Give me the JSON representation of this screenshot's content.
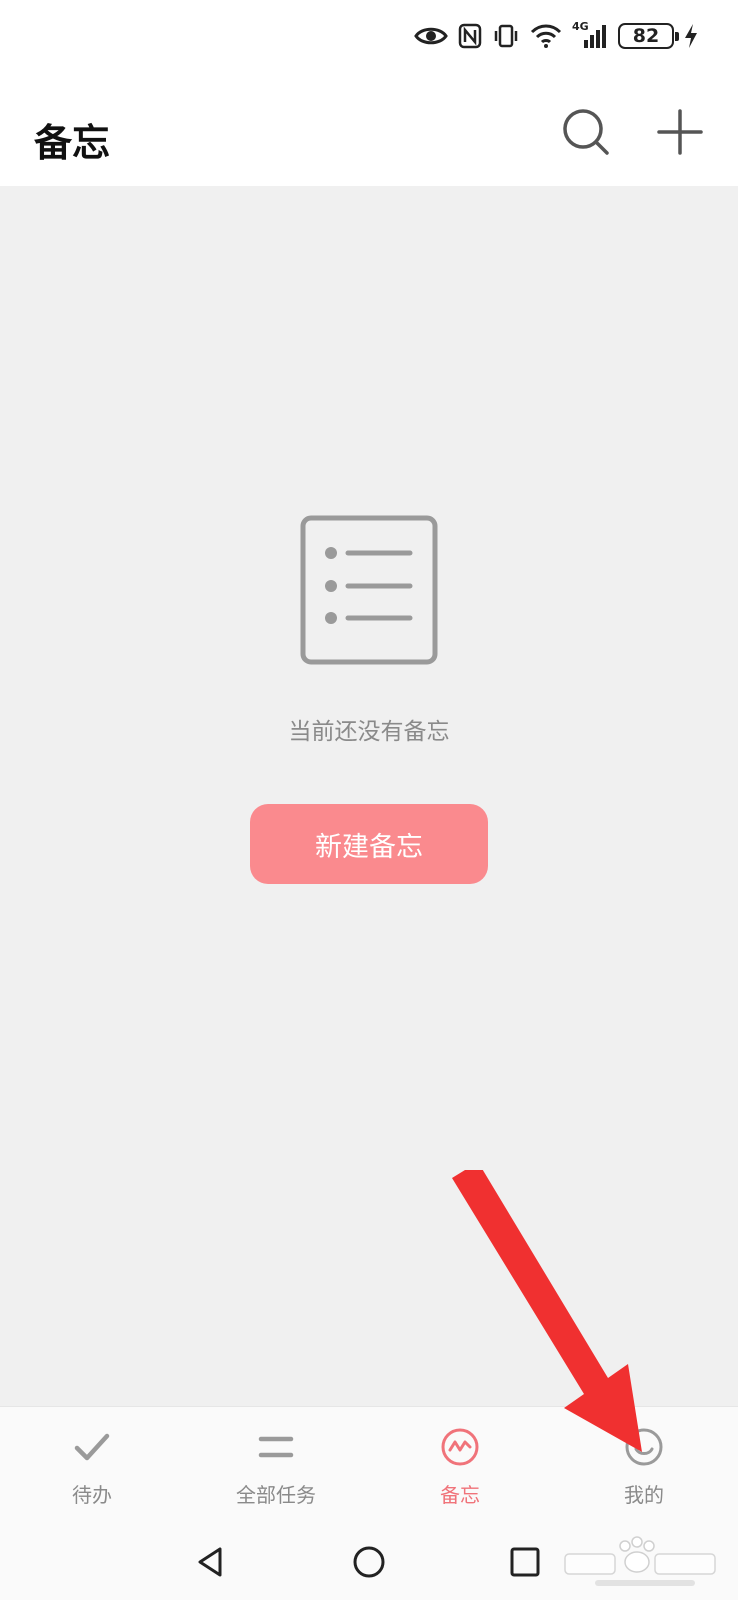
{
  "status_bar": {
    "network_label": "4G",
    "battery": "82"
  },
  "header": {
    "title": "备忘"
  },
  "empty_state": {
    "message": "当前还没有备忘",
    "button_label": "新建备忘"
  },
  "tabs": [
    {
      "label": "待办",
      "icon": "check-icon",
      "active": false
    },
    {
      "label": "全部任务",
      "icon": "equals-icon",
      "active": false
    },
    {
      "label": "备忘",
      "icon": "memo-wave-icon",
      "active": true
    },
    {
      "label": "我的",
      "icon": "smiley-icon",
      "active": false
    }
  ],
  "nav_bar": {
    "icons": [
      "back-triangle-icon",
      "home-circle-icon",
      "recents-square-icon"
    ]
  },
  "colors": {
    "accent": "#f0737a",
    "button": "#fa8a8e",
    "annotation_arrow": "#f03030",
    "icon_gray": "#9a9a9a"
  }
}
